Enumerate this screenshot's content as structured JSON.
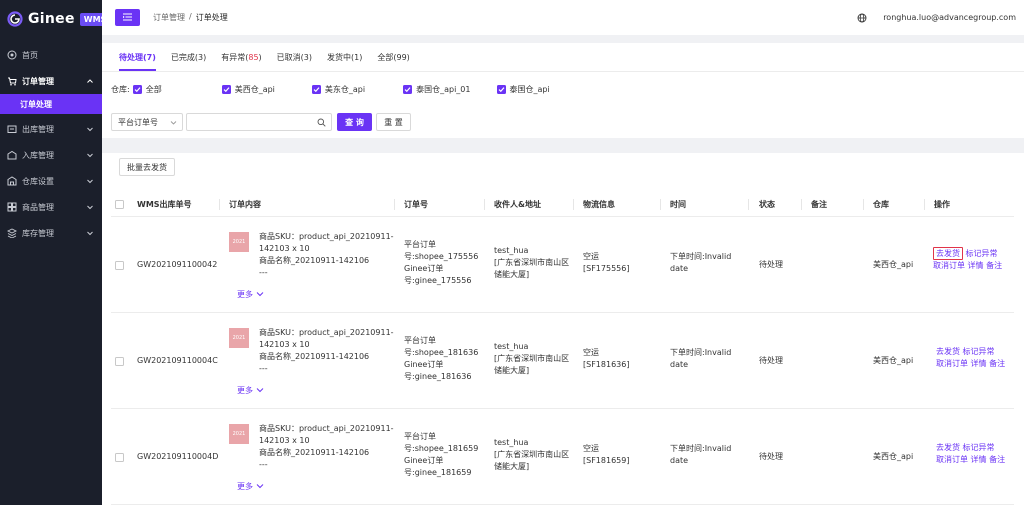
{
  "app": {
    "name": "Ginee",
    "badge": "WMS"
  },
  "sidebar": {
    "items": [
      {
        "label": "首页",
        "icon": "home-icon"
      },
      {
        "label": "订单管理",
        "icon": "cart-icon",
        "open": true
      },
      {
        "label": "出库管理",
        "icon": "outbound-icon"
      },
      {
        "label": "入库管理",
        "icon": "inbound-icon"
      },
      {
        "label": "仓库设置",
        "icon": "warehouse-icon"
      },
      {
        "label": "商品管理",
        "icon": "goods-icon"
      },
      {
        "label": "库存管理",
        "icon": "inventory-icon"
      }
    ],
    "active_sub": "订单处理"
  },
  "header": {
    "breadcrumb": [
      "订单管理",
      "/",
      "订单处理"
    ],
    "user_email": "ronghua.luo@advancegroup.com"
  },
  "tabs": [
    {
      "label": "待处理(7)"
    },
    {
      "label": "已完成(3)"
    },
    {
      "label_prefix": "有异常(",
      "label_count": "85",
      "label_suffix": ")"
    },
    {
      "label": "已取消(3)"
    },
    {
      "label": "发货中(1)"
    },
    {
      "label": "全部(99)"
    }
  ],
  "filters": {
    "warehouse_label": "仓库:",
    "warehouse_options": [
      "全部",
      "美西仓_api",
      "美东仓_api",
      "泰国仓_api_01",
      "泰国仓_api"
    ],
    "search_field_select": "平台订单号",
    "search_value": "",
    "search_button": "查 询",
    "reset_button": "重 置"
  },
  "table": {
    "batch_button": "批量去发货",
    "columns": [
      "WMS出库单号",
      "订单内容",
      "订单号",
      "收件人&地址",
      "物流信息",
      "时间",
      "状态",
      "备注",
      "仓库",
      "操作"
    ],
    "rows": [
      {
        "wms_no": "GW2021091100042",
        "thumb_text": "2021",
        "sku_line1": "商品SKU：product_api_20210911-",
        "sku_line2": "142103 x 10",
        "name_line": "商品名称_20210911-142106",
        "dash": "---",
        "more": "更多",
        "order_l1": "平台订单",
        "order_l2": "号:shopee_175556",
        "order_l3": "Ginee订单",
        "order_l4": "号:ginee_175556",
        "recv_l1": "test_hua",
        "recv_l2": "[广东省深圳市南山区",
        "recv_l3": "储能大厦]",
        "log_l1": "空运",
        "log_l2": "[SF175556]",
        "time_l1": "下单时间:Invalid",
        "time_l2": "date",
        "status": "待处理",
        "remark": "",
        "warehouse": "美西仓_api",
        "act_ship": "去发货",
        "act_mark": "标记异常",
        "act_cancel": "取消订单",
        "act_detail": "详情",
        "act_note": "备注"
      },
      {
        "wms_no": "GW202109110004C",
        "thumb_text": "2021",
        "sku_line1": "商品SKU：product_api_20210911-",
        "sku_line2": "142103 x 10",
        "name_line": "商品名称_20210911-142106",
        "dash": "---",
        "more": "更多",
        "order_l1": "平台订单",
        "order_l2": "号:shopee_181636",
        "order_l3": "Ginee订单",
        "order_l4": "号:ginee_181636",
        "recv_l1": "test_hua",
        "recv_l2": "[广东省深圳市南山区",
        "recv_l3": "储能大厦]",
        "log_l1": "空运",
        "log_l2": "[SF181636]",
        "time_l1": "下单时间:Invalid",
        "time_l2": "date",
        "status": "待处理",
        "remark": "",
        "warehouse": "美西仓_api",
        "act_ship": "去发货",
        "act_mark": "标记异常",
        "act_cancel": "取消订单",
        "act_detail": "详情",
        "act_note": "备注"
      },
      {
        "wms_no": "GW202109110004D",
        "thumb_text": "2021",
        "sku_line1": "商品SKU：product_api_20210911-",
        "sku_line2": "142103 x 10",
        "name_line": "商品名称_20210911-142106",
        "dash": "---",
        "more": "更多",
        "order_l1": "平台订单",
        "order_l2": "号:shopee_181659",
        "order_l3": "Ginee订单",
        "order_l4": "号:ginee_181659",
        "recv_l1": "test_hua",
        "recv_l2": "[广东省深圳市南山区",
        "recv_l3": "储能大厦]",
        "log_l1": "空运",
        "log_l2": "[SF181659]",
        "time_l1": "下单时间:Invalid",
        "time_l2": "date",
        "status": "待处理",
        "remark": "",
        "warehouse": "美西仓_api",
        "act_ship": "去发货",
        "act_mark": "标记异常",
        "act_cancel": "取消订单",
        "act_detail": "详情",
        "act_note": "备注"
      }
    ]
  },
  "colors": {
    "accent": "#6a33f5",
    "sidebar_bg": "#1b1f2b",
    "error": "#e0344a"
  }
}
